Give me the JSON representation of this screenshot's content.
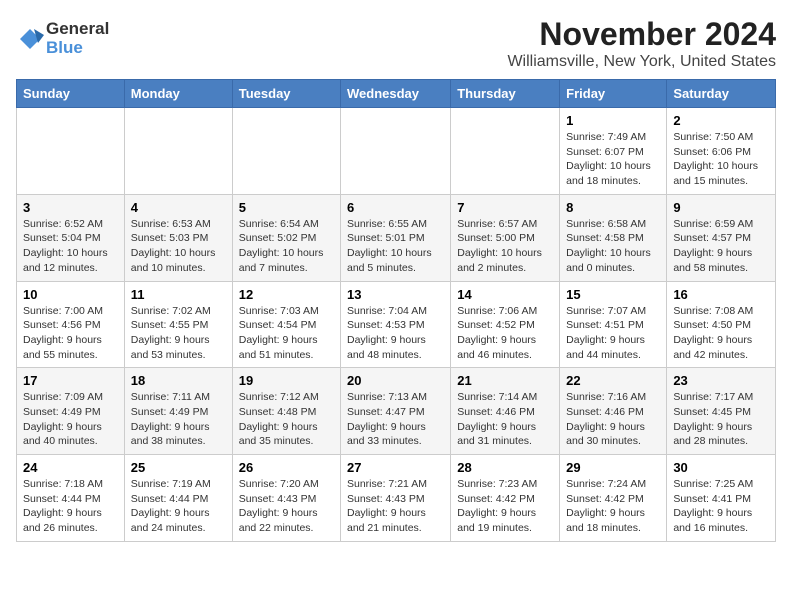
{
  "header": {
    "logo_general": "General",
    "logo_blue": "Blue",
    "month_title": "November 2024",
    "location": "Williamsville, New York, United States"
  },
  "weekdays": [
    "Sunday",
    "Monday",
    "Tuesday",
    "Wednesday",
    "Thursday",
    "Friday",
    "Saturday"
  ],
  "weeks": [
    [
      {
        "day": "",
        "info": ""
      },
      {
        "day": "",
        "info": ""
      },
      {
        "day": "",
        "info": ""
      },
      {
        "day": "",
        "info": ""
      },
      {
        "day": "",
        "info": ""
      },
      {
        "day": "1",
        "info": "Sunrise: 7:49 AM\nSunset: 6:07 PM\nDaylight: 10 hours and 18 minutes."
      },
      {
        "day": "2",
        "info": "Sunrise: 7:50 AM\nSunset: 6:06 PM\nDaylight: 10 hours and 15 minutes."
      }
    ],
    [
      {
        "day": "3",
        "info": "Sunrise: 6:52 AM\nSunset: 5:04 PM\nDaylight: 10 hours and 12 minutes."
      },
      {
        "day": "4",
        "info": "Sunrise: 6:53 AM\nSunset: 5:03 PM\nDaylight: 10 hours and 10 minutes."
      },
      {
        "day": "5",
        "info": "Sunrise: 6:54 AM\nSunset: 5:02 PM\nDaylight: 10 hours and 7 minutes."
      },
      {
        "day": "6",
        "info": "Sunrise: 6:55 AM\nSunset: 5:01 PM\nDaylight: 10 hours and 5 minutes."
      },
      {
        "day": "7",
        "info": "Sunrise: 6:57 AM\nSunset: 5:00 PM\nDaylight: 10 hours and 2 minutes."
      },
      {
        "day": "8",
        "info": "Sunrise: 6:58 AM\nSunset: 4:58 PM\nDaylight: 10 hours and 0 minutes."
      },
      {
        "day": "9",
        "info": "Sunrise: 6:59 AM\nSunset: 4:57 PM\nDaylight: 9 hours and 58 minutes."
      }
    ],
    [
      {
        "day": "10",
        "info": "Sunrise: 7:00 AM\nSunset: 4:56 PM\nDaylight: 9 hours and 55 minutes."
      },
      {
        "day": "11",
        "info": "Sunrise: 7:02 AM\nSunset: 4:55 PM\nDaylight: 9 hours and 53 minutes."
      },
      {
        "day": "12",
        "info": "Sunrise: 7:03 AM\nSunset: 4:54 PM\nDaylight: 9 hours and 51 minutes."
      },
      {
        "day": "13",
        "info": "Sunrise: 7:04 AM\nSunset: 4:53 PM\nDaylight: 9 hours and 48 minutes."
      },
      {
        "day": "14",
        "info": "Sunrise: 7:06 AM\nSunset: 4:52 PM\nDaylight: 9 hours and 46 minutes."
      },
      {
        "day": "15",
        "info": "Sunrise: 7:07 AM\nSunset: 4:51 PM\nDaylight: 9 hours and 44 minutes."
      },
      {
        "day": "16",
        "info": "Sunrise: 7:08 AM\nSunset: 4:50 PM\nDaylight: 9 hours and 42 minutes."
      }
    ],
    [
      {
        "day": "17",
        "info": "Sunrise: 7:09 AM\nSunset: 4:49 PM\nDaylight: 9 hours and 40 minutes."
      },
      {
        "day": "18",
        "info": "Sunrise: 7:11 AM\nSunset: 4:49 PM\nDaylight: 9 hours and 38 minutes."
      },
      {
        "day": "19",
        "info": "Sunrise: 7:12 AM\nSunset: 4:48 PM\nDaylight: 9 hours and 35 minutes."
      },
      {
        "day": "20",
        "info": "Sunrise: 7:13 AM\nSunset: 4:47 PM\nDaylight: 9 hours and 33 minutes."
      },
      {
        "day": "21",
        "info": "Sunrise: 7:14 AM\nSunset: 4:46 PM\nDaylight: 9 hours and 31 minutes."
      },
      {
        "day": "22",
        "info": "Sunrise: 7:16 AM\nSunset: 4:46 PM\nDaylight: 9 hours and 30 minutes."
      },
      {
        "day": "23",
        "info": "Sunrise: 7:17 AM\nSunset: 4:45 PM\nDaylight: 9 hours and 28 minutes."
      }
    ],
    [
      {
        "day": "24",
        "info": "Sunrise: 7:18 AM\nSunset: 4:44 PM\nDaylight: 9 hours and 26 minutes."
      },
      {
        "day": "25",
        "info": "Sunrise: 7:19 AM\nSunset: 4:44 PM\nDaylight: 9 hours and 24 minutes."
      },
      {
        "day": "26",
        "info": "Sunrise: 7:20 AM\nSunset: 4:43 PM\nDaylight: 9 hours and 22 minutes."
      },
      {
        "day": "27",
        "info": "Sunrise: 7:21 AM\nSunset: 4:43 PM\nDaylight: 9 hours and 21 minutes."
      },
      {
        "day": "28",
        "info": "Sunrise: 7:23 AM\nSunset: 4:42 PM\nDaylight: 9 hours and 19 minutes."
      },
      {
        "day": "29",
        "info": "Sunrise: 7:24 AM\nSunset: 4:42 PM\nDaylight: 9 hours and 18 minutes."
      },
      {
        "day": "30",
        "info": "Sunrise: 7:25 AM\nSunset: 4:41 PM\nDaylight: 9 hours and 16 minutes."
      }
    ]
  ]
}
